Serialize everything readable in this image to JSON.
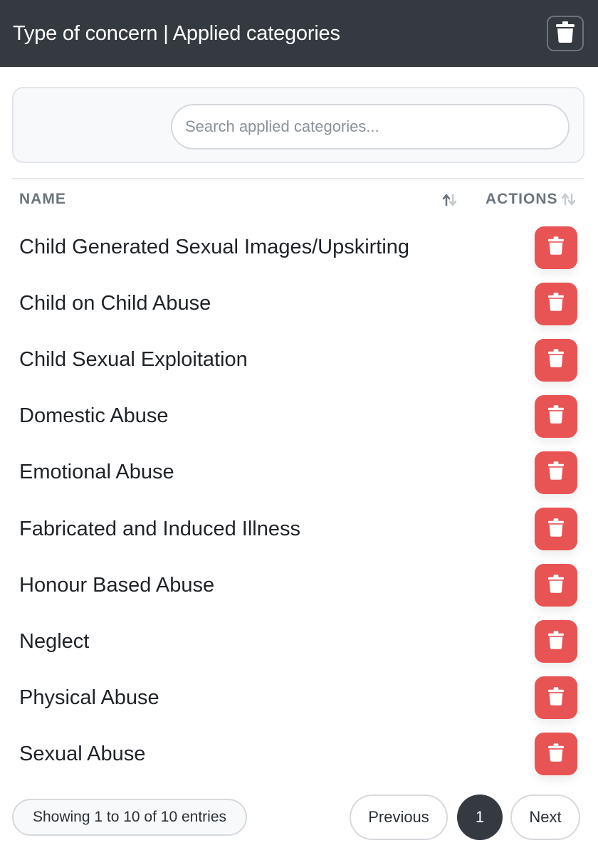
{
  "header": {
    "title": "Type of concern | Applied categories",
    "trash_icon": "trash-icon"
  },
  "search": {
    "placeholder": "Search applied categories...",
    "value": ""
  },
  "table": {
    "columns": [
      "NAME",
      "ACTIONS"
    ],
    "rows": [
      "Child Generated Sexual Images/Upskirting",
      "Child on Child Abuse",
      "Child Sexual Exploitation",
      "Domestic Abuse",
      "Emotional Abuse",
      "Fabricated and Induced Illness",
      "Honour Based Abuse",
      "Neglect",
      "Physical Abuse",
      "Sexual Abuse"
    ],
    "row_action_icon": "trash-icon"
  },
  "footer": {
    "info": "Showing 1 to 10 of 10 entries",
    "prev_label": "Previous",
    "current_page": "1",
    "next_label": "Next"
  },
  "colors": {
    "header_bg": "#343a40",
    "delete_button": "#e85454",
    "active_page": "#343a40"
  }
}
